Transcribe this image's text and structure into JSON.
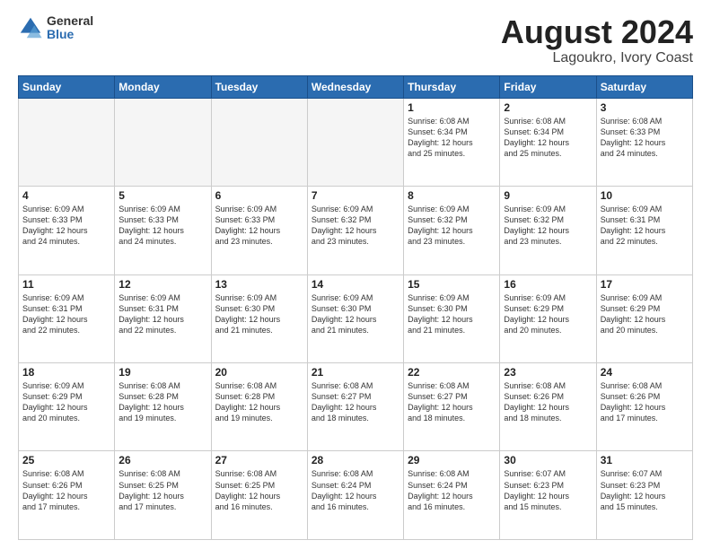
{
  "logo": {
    "general": "General",
    "blue": "Blue"
  },
  "title": "August 2024",
  "subtitle": "Lagoukro, Ivory Coast",
  "days_of_week": [
    "Sunday",
    "Monday",
    "Tuesday",
    "Wednesday",
    "Thursday",
    "Friday",
    "Saturday"
  ],
  "weeks": [
    [
      {
        "day": "",
        "info": ""
      },
      {
        "day": "",
        "info": ""
      },
      {
        "day": "",
        "info": ""
      },
      {
        "day": "",
        "info": ""
      },
      {
        "day": "1",
        "info": "Sunrise: 6:08 AM\nSunset: 6:34 PM\nDaylight: 12 hours\nand 25 minutes."
      },
      {
        "day": "2",
        "info": "Sunrise: 6:08 AM\nSunset: 6:34 PM\nDaylight: 12 hours\nand 25 minutes."
      },
      {
        "day": "3",
        "info": "Sunrise: 6:08 AM\nSunset: 6:33 PM\nDaylight: 12 hours\nand 24 minutes."
      }
    ],
    [
      {
        "day": "4",
        "info": "Sunrise: 6:09 AM\nSunset: 6:33 PM\nDaylight: 12 hours\nand 24 minutes."
      },
      {
        "day": "5",
        "info": "Sunrise: 6:09 AM\nSunset: 6:33 PM\nDaylight: 12 hours\nand 24 minutes."
      },
      {
        "day": "6",
        "info": "Sunrise: 6:09 AM\nSunset: 6:33 PM\nDaylight: 12 hours\nand 23 minutes."
      },
      {
        "day": "7",
        "info": "Sunrise: 6:09 AM\nSunset: 6:32 PM\nDaylight: 12 hours\nand 23 minutes."
      },
      {
        "day": "8",
        "info": "Sunrise: 6:09 AM\nSunset: 6:32 PM\nDaylight: 12 hours\nand 23 minutes."
      },
      {
        "day": "9",
        "info": "Sunrise: 6:09 AM\nSunset: 6:32 PM\nDaylight: 12 hours\nand 23 minutes."
      },
      {
        "day": "10",
        "info": "Sunrise: 6:09 AM\nSunset: 6:31 PM\nDaylight: 12 hours\nand 22 minutes."
      }
    ],
    [
      {
        "day": "11",
        "info": "Sunrise: 6:09 AM\nSunset: 6:31 PM\nDaylight: 12 hours\nand 22 minutes."
      },
      {
        "day": "12",
        "info": "Sunrise: 6:09 AM\nSunset: 6:31 PM\nDaylight: 12 hours\nand 22 minutes."
      },
      {
        "day": "13",
        "info": "Sunrise: 6:09 AM\nSunset: 6:30 PM\nDaylight: 12 hours\nand 21 minutes."
      },
      {
        "day": "14",
        "info": "Sunrise: 6:09 AM\nSunset: 6:30 PM\nDaylight: 12 hours\nand 21 minutes."
      },
      {
        "day": "15",
        "info": "Sunrise: 6:09 AM\nSunset: 6:30 PM\nDaylight: 12 hours\nand 21 minutes."
      },
      {
        "day": "16",
        "info": "Sunrise: 6:09 AM\nSunset: 6:29 PM\nDaylight: 12 hours\nand 20 minutes."
      },
      {
        "day": "17",
        "info": "Sunrise: 6:09 AM\nSunset: 6:29 PM\nDaylight: 12 hours\nand 20 minutes."
      }
    ],
    [
      {
        "day": "18",
        "info": "Sunrise: 6:09 AM\nSunset: 6:29 PM\nDaylight: 12 hours\nand 20 minutes."
      },
      {
        "day": "19",
        "info": "Sunrise: 6:08 AM\nSunset: 6:28 PM\nDaylight: 12 hours\nand 19 minutes."
      },
      {
        "day": "20",
        "info": "Sunrise: 6:08 AM\nSunset: 6:28 PM\nDaylight: 12 hours\nand 19 minutes."
      },
      {
        "day": "21",
        "info": "Sunrise: 6:08 AM\nSunset: 6:27 PM\nDaylight: 12 hours\nand 18 minutes."
      },
      {
        "day": "22",
        "info": "Sunrise: 6:08 AM\nSunset: 6:27 PM\nDaylight: 12 hours\nand 18 minutes."
      },
      {
        "day": "23",
        "info": "Sunrise: 6:08 AM\nSunset: 6:26 PM\nDaylight: 12 hours\nand 18 minutes."
      },
      {
        "day": "24",
        "info": "Sunrise: 6:08 AM\nSunset: 6:26 PM\nDaylight: 12 hours\nand 17 minutes."
      }
    ],
    [
      {
        "day": "25",
        "info": "Sunrise: 6:08 AM\nSunset: 6:26 PM\nDaylight: 12 hours\nand 17 minutes."
      },
      {
        "day": "26",
        "info": "Sunrise: 6:08 AM\nSunset: 6:25 PM\nDaylight: 12 hours\nand 17 minutes."
      },
      {
        "day": "27",
        "info": "Sunrise: 6:08 AM\nSunset: 6:25 PM\nDaylight: 12 hours\nand 16 minutes."
      },
      {
        "day": "28",
        "info": "Sunrise: 6:08 AM\nSunset: 6:24 PM\nDaylight: 12 hours\nand 16 minutes."
      },
      {
        "day": "29",
        "info": "Sunrise: 6:08 AM\nSunset: 6:24 PM\nDaylight: 12 hours\nand 16 minutes."
      },
      {
        "day": "30",
        "info": "Sunrise: 6:07 AM\nSunset: 6:23 PM\nDaylight: 12 hours\nand 15 minutes."
      },
      {
        "day": "31",
        "info": "Sunrise: 6:07 AM\nSunset: 6:23 PM\nDaylight: 12 hours\nand 15 minutes."
      }
    ]
  ]
}
